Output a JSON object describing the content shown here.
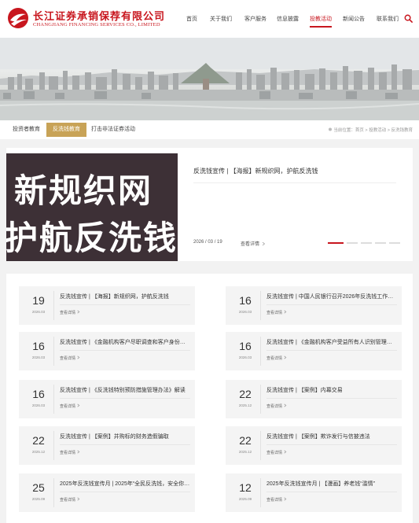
{
  "header": {
    "logo_cn": "长江证券承销保荐有限公司",
    "logo_en": "CHANGJIANG FINANCING SERVICES CO., LIMITED",
    "nav": [
      "首页",
      "关于我们",
      "客户服务",
      "信息披露",
      "投教活动",
      "新闻公告",
      "联系我们"
    ],
    "active_nav": "投教活动",
    "brand_color": "#c8161e"
  },
  "subnav": {
    "tabs": [
      "投资者教育",
      "反洗钱教育",
      "打击非法证券活动"
    ],
    "active_tab": "反洗钱教育",
    "crumb_prefix": "当前位置：",
    "crumbs": [
      "首页",
      "投教活动",
      "反洗钱教育"
    ],
    "crumb_sep": " > ",
    "accent_color": "#c8a357"
  },
  "featured": {
    "image_line1": "新规织网",
    "image_line2": "护航反洗钱",
    "title": "反洗钱宣传 | 【海报】新规织网，护航反洗钱",
    "date": "2026 / 03 / 19",
    "more": "查看详情",
    "slide_count": 5,
    "active_slide": 1
  },
  "articles": [
    {
      "day": "19",
      "ym": "2026.03",
      "title": "反洗钱宣传 | 【海报】新规织网，护航反洗钱",
      "more": "查看详情"
    },
    {
      "day": "16",
      "ym": "2026.03",
      "title": "反洗钱宣传 | 中国人民银行召开2026年反洗钱工作会议",
      "more": "查看详情"
    },
    {
      "day": "16",
      "ym": "2026.03",
      "title": "反洗钱宣传 | 《金融机构客户尽职调查和客户身份资料及交易记录保存管理办法》",
      "more": "查看详情"
    },
    {
      "day": "16",
      "ym": "2026.03",
      "title": "反洗钱宣传 | 《金融机构客户受益所有人识别管理办法》",
      "more": "查看详情"
    },
    {
      "day": "16",
      "ym": "2026.03",
      "title": "反洗钱宣传 | 《反洗钱特别预防措施管理办法》解读",
      "more": "查看详情"
    },
    {
      "day": "22",
      "ym": "2025.12",
      "title": "反洗钱宣传 | 【案例】内幕交易",
      "more": "查看详情"
    },
    {
      "day": "22",
      "ym": "2025.12",
      "title": "反洗钱宣传 | 【案例】并购标的财务造假骗取",
      "more": "查看详情"
    },
    {
      "day": "22",
      "ym": "2025.12",
      "title": "反洗钱宣传 | 【案例】欺诈发行与信披违法",
      "more": "查看详情"
    },
    {
      "day": "25",
      "ym": "2025.09",
      "title": "2025年反洗钱宣传月 | 2025年“全民反洗钱，安全你我他”",
      "more": "查看详情"
    },
    {
      "day": "12",
      "ym": "2025.09",
      "title": "2025年反洗钱宣传月 | 【漫画】养老钱“滥情”",
      "more": "查看详情"
    }
  ]
}
